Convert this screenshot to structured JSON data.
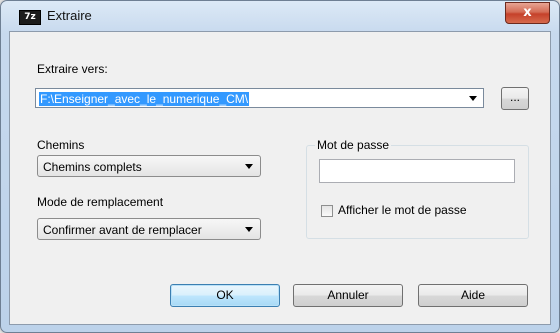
{
  "window": {
    "icon_text": "7z",
    "title": "Extraire",
    "close_glyph": "x"
  },
  "extract_to": {
    "label": "Extraire vers:",
    "value": "F:\\Enseigner_avec_le_numerique_CM\\",
    "browse_label": "..."
  },
  "paths": {
    "label": "Chemins",
    "selected": "Chemins complets"
  },
  "overwrite": {
    "label": "Mode de remplacement",
    "selected": "Confirmer avant de remplacer"
  },
  "password": {
    "group_label": "Mot de passe",
    "value": "",
    "show_label": "Afficher le mot de passe",
    "show_checked": false
  },
  "buttons": {
    "ok": "OK",
    "cancel": "Annuler",
    "help": "Aide"
  },
  "colors": {
    "selection": "#3399ff",
    "close_button": "#c5412a",
    "default_button_border": "#3c7fb1"
  }
}
